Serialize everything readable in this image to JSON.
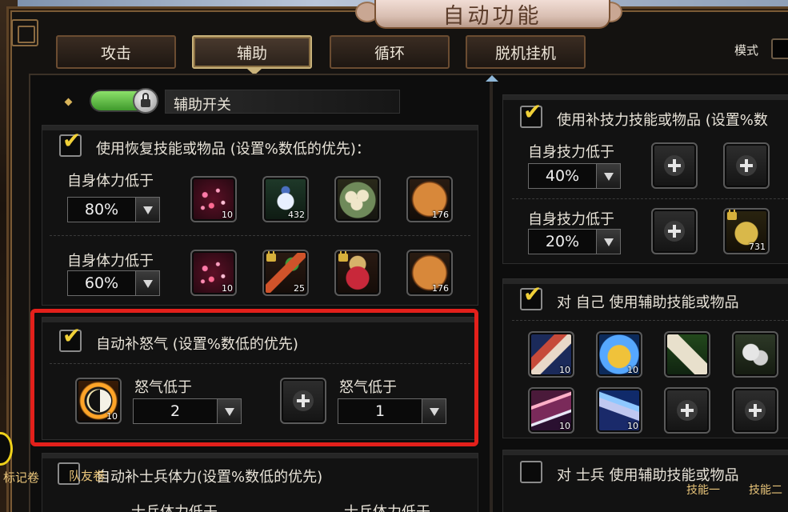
{
  "window": {
    "title": "自动功能"
  },
  "tabs": [
    {
      "label": "攻击",
      "active": false
    },
    {
      "label": "辅助",
      "active": true
    },
    {
      "label": "循环",
      "active": false
    },
    {
      "label": "脱机挂机",
      "active": false
    }
  ],
  "mode": {
    "label": "模式"
  },
  "assist_switch": {
    "label": "辅助开关",
    "on": true,
    "locked": true
  },
  "recover_section": {
    "title": "使用恢复技能或物品 (设置%数低的优先)：",
    "checked": true,
    "rows": [
      {
        "label": "自身体力低于",
        "value": "80%",
        "slots": [
          {
            "icon": "pink-sparkle-skill-icon",
            "count": "10"
          },
          {
            "icon": "potion-vase-icon",
            "count": "432"
          },
          {
            "icon": "steamed-buns-icon",
            "count": ""
          },
          {
            "icon": "mooncake-icon",
            "count": "176"
          }
        ]
      },
      {
        "label": "自身体力低于",
        "value": "60%",
        "slots": [
          {
            "icon": "pink-sparkle-skill-icon",
            "count": "10"
          },
          {
            "icon": "carrot-icon",
            "count": "25",
            "locked": true
          },
          {
            "icon": "honey-jar-icon",
            "count": "",
            "locked": true
          },
          {
            "icon": "mooncake-icon",
            "count": "176"
          }
        ]
      }
    ]
  },
  "rage_section": {
    "title": "自动补怒气 (设置%数低的优先)",
    "checked": true,
    "entries": [
      {
        "icon": "yin-yang-skill-icon",
        "count": "10",
        "label": "怒气低于",
        "value": "2"
      },
      {
        "icon": "add-icon",
        "count": "",
        "label": "怒气低于",
        "value": "1"
      }
    ]
  },
  "soldier_hp_section": {
    "title": "自动补士兵体力(设置%数低的优先)",
    "checked": false,
    "overlay_left": "标记卷",
    "overlay_mid": "队友卷",
    "partial_label": "士兵体力低于"
  },
  "mp_section": {
    "title": "使用补技力技能或物品 (设置%数",
    "checked": true,
    "rows": [
      {
        "label": "自身技力低于",
        "value": "40%",
        "slots": [
          {
            "icon": "add-icon"
          },
          {
            "icon": "add-icon"
          }
        ]
      },
      {
        "label": "自身技力低于",
        "value": "20%",
        "slots": [
          {
            "icon": "add-icon"
          },
          {
            "icon": "golden-jug-icon",
            "count": "731",
            "locked": true
          }
        ]
      }
    ]
  },
  "self_buff_section": {
    "title": "对 自己 使用辅助技能或物品",
    "checked": true,
    "slots": [
      {
        "icon": "scroll-red-icon",
        "count": "10"
      },
      {
        "icon": "golden-bell-icon",
        "count": "10"
      },
      {
        "icon": "scroll-green-icon",
        "count": ""
      },
      {
        "icon": "dice-icon",
        "count": ""
      },
      {
        "icon": "crossed-blades-icon",
        "count": "10"
      },
      {
        "icon": "ice-claw-icon",
        "count": "10"
      },
      {
        "icon": "add-icon",
        "count": ""
      },
      {
        "icon": "add-icon",
        "count": ""
      }
    ]
  },
  "soldier_buff_section": {
    "title": "对 士兵 使用辅助技能或物品",
    "checked": false
  },
  "skill_labels": [
    "技能一",
    "技能二"
  ],
  "colors": {
    "highlight": "#e3201b",
    "check_tick": "#f0d038",
    "toggle_on": "#5cbf3a"
  }
}
